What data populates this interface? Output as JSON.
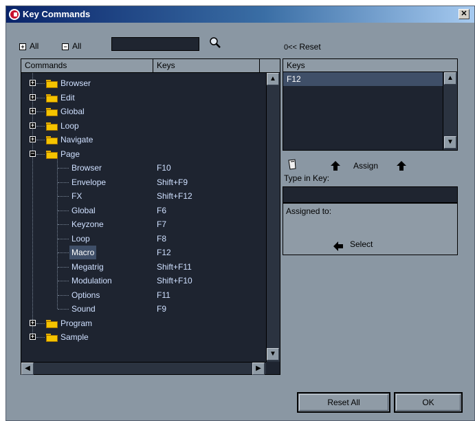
{
  "window": {
    "title": "Key Commands",
    "close_glyph": "✕"
  },
  "toolbar": {
    "expand_all_label": "All",
    "collapse_all_label": "All",
    "search_value": ""
  },
  "tree": {
    "col_commands": "Commands",
    "col_keys": "Keys",
    "rows": [
      {
        "label": "Browser",
        "key": "",
        "level": 0,
        "expanded": false
      },
      {
        "label": "Edit",
        "key": "",
        "level": 0,
        "expanded": false
      },
      {
        "label": "Global",
        "key": "",
        "level": 0,
        "expanded": false
      },
      {
        "label": "Loop",
        "key": "",
        "level": 0,
        "expanded": false
      },
      {
        "label": "Navigate",
        "key": "",
        "level": 0,
        "expanded": false
      },
      {
        "label": "Page",
        "key": "",
        "level": 0,
        "expanded": true
      },
      {
        "label": "Browser",
        "key": "F10",
        "level": 1
      },
      {
        "label": "Envelope",
        "key": "Shift+F9",
        "level": 1
      },
      {
        "label": "FX",
        "key": "Shift+F12",
        "level": 1
      },
      {
        "label": "Global",
        "key": "F6",
        "level": 1
      },
      {
        "label": "Keyzone",
        "key": "F7",
        "level": 1
      },
      {
        "label": "Loop",
        "key": "F8",
        "level": 1
      },
      {
        "label": "Macro",
        "key": "F12",
        "level": 1,
        "selected": true
      },
      {
        "label": "Megatrig",
        "key": "Shift+F11",
        "level": 1
      },
      {
        "label": "Modulation",
        "key": "Shift+F10",
        "level": 1
      },
      {
        "label": "Options",
        "key": "F11",
        "level": 1
      },
      {
        "label": "Sound",
        "key": "F9",
        "level": 1
      },
      {
        "label": "Program",
        "key": "",
        "level": 0,
        "expanded": false
      },
      {
        "label": "Sample",
        "key": "",
        "level": 0,
        "expanded": false
      }
    ]
  },
  "right": {
    "reset_label": "Reset",
    "keys_header": "Keys",
    "keys": [
      "F12"
    ],
    "assign_label": "Assign",
    "type_in_label": "Type in Key:",
    "type_in_value": "",
    "assigned_to_label": "Assigned to:",
    "select_label": "Select"
  },
  "footer": {
    "reset_all_label": "Reset All",
    "ok_label": "OK"
  },
  "colors": {
    "title_bar": "#0a246a",
    "panel_bg": "#1e2430",
    "window_bg": "#8a97a3",
    "tree_text": "#cfe0ff",
    "selection": "#3f4f68"
  }
}
